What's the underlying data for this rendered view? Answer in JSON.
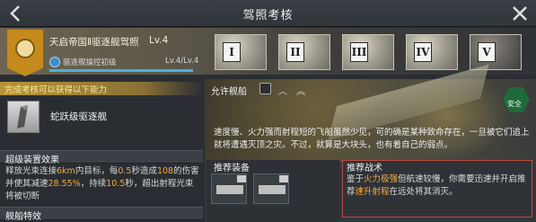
{
  "window": {
    "title": "驾照考核"
  },
  "license": {
    "name": "天启帝国Ⅱ驱逐舰驾照",
    "level": "Lv.4",
    "progress_label": "驱逐舰操控初级",
    "progress_value": "Lv.4/Lv.4",
    "progress_fraction": 1.0
  },
  "tiers": [
    {
      "numeral": "I"
    },
    {
      "numeral": "II"
    },
    {
      "numeral": "III"
    },
    {
      "numeral": "IV"
    },
    {
      "numeral": "V"
    }
  ],
  "requirements": {
    "banner": "完成考核可以获得以下能力",
    "ship_name": "蛇跃级驱逐舰"
  },
  "effects": {
    "title": "超级装置效果",
    "text_parts": [
      "释放光束连接",
      "6km",
      "内目标，每",
      "0.5",
      "秒造成",
      "108",
      "的伤害并使其减速",
      "28.55%",
      "，持续",
      "10.5",
      "秒，超出射程光束将被切断"
    ]
  },
  "ship_traits": {
    "title": "舰船特效"
  },
  "allowed": {
    "label": "允许舰船",
    "safe_badge": "安全",
    "description": "速度慢、火力强而射程短的飞船虽然少见，可的确是某种致命存在，一旦被它们追上就将遭遇灭顶之灾。不过，就算是大块头，也有着自己的弱点。"
  },
  "recommended_equipment": {
    "title": "推荐装备"
  },
  "recommended_tactics": {
    "title": "推荐战术",
    "text_parts": [
      "鉴于",
      "火力极强",
      "但航速较慢，你需要迅速并开启推荐",
      "速升射程",
      "在远处将其消灭。"
    ]
  },
  "colors": {
    "accent": "#f3a93c",
    "badge": "#c48a1c",
    "safe": "#1f6a3a",
    "highlight_border": "#c04a3c"
  },
  "icons": {
    "back": "chevron-left-icon",
    "close": "close-icon",
    "badge": "license-badge-icon",
    "safe": "shield-icon"
  }
}
